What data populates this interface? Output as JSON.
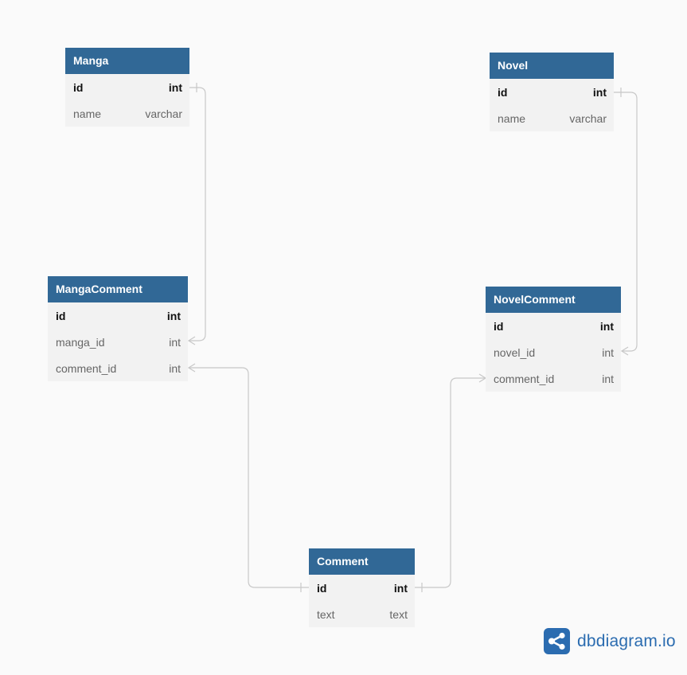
{
  "tables": {
    "manga": {
      "name": "Manga",
      "fields": [
        {
          "name": "id",
          "type": "int",
          "pk": true
        },
        {
          "name": "name",
          "type": "varchar",
          "pk": false
        }
      ]
    },
    "novel": {
      "name": "Novel",
      "fields": [
        {
          "name": "id",
          "type": "int",
          "pk": true
        },
        {
          "name": "name",
          "type": "varchar",
          "pk": false
        }
      ]
    },
    "manga_comment": {
      "name": "MangaComment",
      "fields": [
        {
          "name": "id",
          "type": "int",
          "pk": true
        },
        {
          "name": "manga_id",
          "type": "int",
          "pk": false
        },
        {
          "name": "comment_id",
          "type": "int",
          "pk": false
        }
      ]
    },
    "novel_comment": {
      "name": "NovelComment",
      "fields": [
        {
          "name": "id",
          "type": "int",
          "pk": true
        },
        {
          "name": "novel_id",
          "type": "int",
          "pk": false
        },
        {
          "name": "comment_id",
          "type": "int",
          "pk": false
        }
      ]
    },
    "comment": {
      "name": "Comment",
      "fields": [
        {
          "name": "id",
          "type": "int",
          "pk": true
        },
        {
          "name": "text",
          "type": "text",
          "pk": false
        }
      ]
    }
  },
  "relationships": [
    {
      "from": "manga.id",
      "to": "manga_comment.manga_id",
      "cardinality": "one-to-many"
    },
    {
      "from": "novel.id",
      "to": "novel_comment.novel_id",
      "cardinality": "one-to-many"
    },
    {
      "from": "comment.id",
      "to": "manga_comment.comment_id",
      "cardinality": "one-to-many"
    },
    {
      "from": "comment.id",
      "to": "novel_comment.comment_id",
      "cardinality": "one-to-many"
    }
  ],
  "colors": {
    "header": "#316896",
    "line": "#c8c8c8",
    "logo": "#2b6cb0"
  },
  "logo": {
    "text": "dbdiagram.io",
    "icon": "share-nodes-icon"
  }
}
